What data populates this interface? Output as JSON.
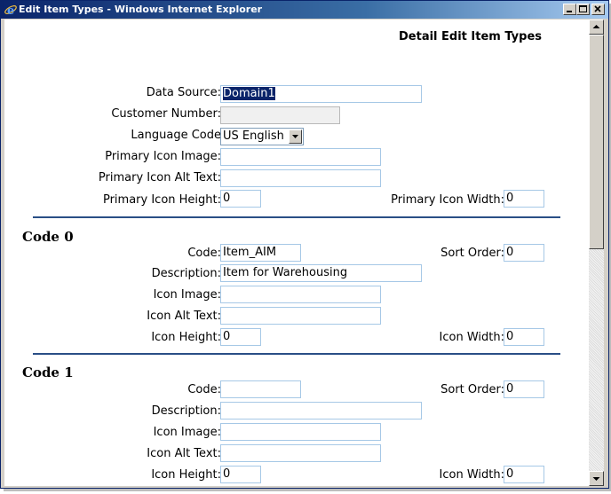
{
  "window": {
    "title": "Edit Item Types - Windows Internet Explorer",
    "title_bar_color": "#0a246a",
    "icons": {
      "browser": "ie-icon",
      "minimize": "minimize-icon",
      "maximize": "maximize-icon",
      "close": "close-icon"
    }
  },
  "page": {
    "heading": "Detail Edit Item Types",
    "accent_rule_color": "#2a4f86"
  },
  "general": {
    "data_source_label": "Data Source:",
    "data_source_value": "Domain1",
    "customer_number_label": "Customer Number:",
    "customer_number_value": "",
    "language_code_label": "Language Code",
    "language_code_value": "US English",
    "primary_icon_image_label": "Primary Icon Image:",
    "primary_icon_image_value": "",
    "primary_icon_alt_label": "Primary Icon Alt Text:",
    "primary_icon_alt_value": "",
    "primary_icon_height_label": "Primary Icon Height:",
    "primary_icon_height_value": "0",
    "primary_icon_width_label": "Primary Icon Width:",
    "primary_icon_width_value": "0"
  },
  "codes": [
    {
      "title": "Code 0",
      "code_label": "Code:",
      "code_value": "Item_AIM",
      "sort_label": "Sort Order:",
      "sort_value": "0",
      "desc_label": "Description:",
      "desc_value": "Item for Warehousing",
      "icon_image_label": "Icon Image:",
      "icon_image_value": "",
      "icon_alt_label": "Icon Alt Text:",
      "icon_alt_value": "",
      "icon_height_label": "Icon Height:",
      "icon_height_value": "0",
      "icon_width_label": "Icon Width:",
      "icon_width_value": "0"
    },
    {
      "title": "Code 1",
      "code_label": "Code:",
      "code_value": "",
      "sort_label": "Sort Order:",
      "sort_value": "0",
      "desc_label": "Description:",
      "desc_value": "",
      "icon_image_label": "Icon Image:",
      "icon_image_value": "",
      "icon_alt_label": "Icon Alt Text:",
      "icon_alt_value": "",
      "icon_height_label": "Icon Height:",
      "icon_height_value": "0",
      "icon_width_label": "Icon Width:",
      "icon_width_value": "0"
    }
  ],
  "scrollbar": {
    "up_icon": "scroll-up-icon",
    "down_icon": "scroll-down-icon"
  }
}
